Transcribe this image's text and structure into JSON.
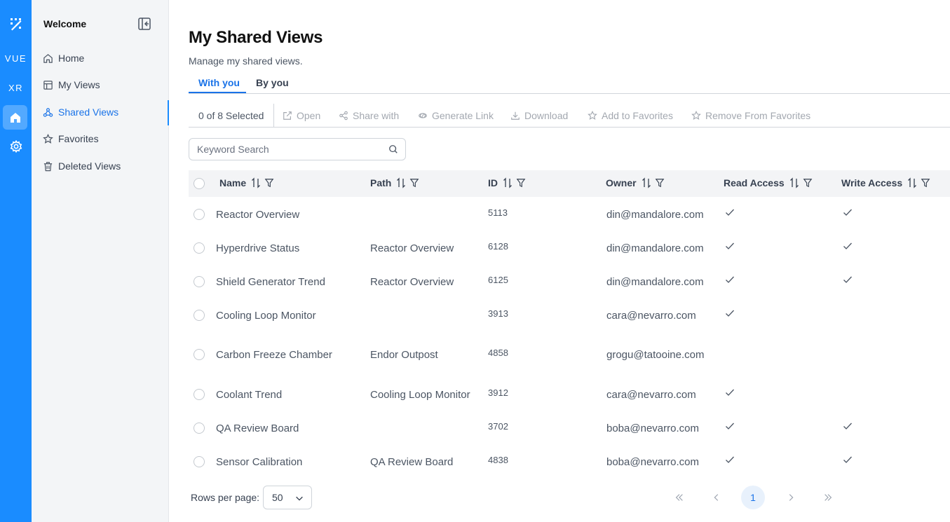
{
  "rail": {
    "logo_icon": "logo-icon",
    "vue_label": "VUE",
    "xr_label": "XR",
    "home_icon": "home-icon",
    "settings_icon": "gear-icon",
    "color": "#1a8cff"
  },
  "nav": {
    "title": "Welcome",
    "items": [
      {
        "label": "Home",
        "icon": "home-icon"
      },
      {
        "label": "My Views",
        "icon": "layout-icon"
      },
      {
        "label": "Shared Views",
        "icon": "share-nodes-icon",
        "active": true
      },
      {
        "label": "Favorites",
        "icon": "star-icon"
      },
      {
        "label": "Deleted Views",
        "icon": "trash-icon"
      }
    ]
  },
  "page": {
    "title": "My Shared Views",
    "subtitle": "Manage my shared views."
  },
  "tabs": [
    {
      "label": "With you",
      "active": true
    },
    {
      "label": "By you",
      "active": false
    }
  ],
  "toolbar": {
    "selected": "0 of 8 Selected",
    "actions": [
      {
        "label": "Open",
        "icon": "external-link-icon"
      },
      {
        "label": "Share with",
        "icon": "share-icon"
      },
      {
        "label": "Generate Link",
        "icon": "link-icon"
      },
      {
        "label": "Download",
        "icon": "download-icon"
      },
      {
        "label": "Add to Favorites",
        "icon": "star-icon"
      },
      {
        "label": "Remove From Favorites",
        "icon": "star-icon"
      }
    ]
  },
  "search": {
    "placeholder": "Keyword Search",
    "value": ""
  },
  "table": {
    "columns": [
      "Name",
      "Path",
      "ID",
      "Owner",
      "Read Access",
      "Write Access"
    ],
    "rows": [
      {
        "name": "Reactor Overview",
        "path": "",
        "id": "5113",
        "owner": "din@mandalore.com",
        "read": true,
        "write": true
      },
      {
        "name": "Hyperdrive Status",
        "path": "Reactor Overview",
        "id": "6128",
        "owner": "din@mandalore.com",
        "read": true,
        "write": true
      },
      {
        "name": "Shield Generator Trend",
        "path": "Reactor Overview",
        "id": "6125",
        "owner": "din@mandalore.com",
        "read": true,
        "write": true
      },
      {
        "name": "Cooling Loop Monitor",
        "path": "",
        "id": "3913",
        "owner": "cara@nevarro.com",
        "read": true,
        "write": false
      },
      {
        "name": "Carbon Freeze Chamber",
        "path": "Endor Outpost",
        "id": "4858",
        "owner": "grogu@tatooine.com",
        "read": false,
        "write": false
      },
      {
        "name": "Coolant Trend",
        "path": "Cooling Loop Monitor",
        "id": "3912",
        "owner": "cara@nevarro.com",
        "read": true,
        "write": false
      },
      {
        "name": "QA Review Board",
        "path": "",
        "id": "3702",
        "owner": "boba@nevarro.com",
        "read": true,
        "write": true
      },
      {
        "name": "Sensor Calibration",
        "path": "QA Review Board",
        "id": "4838",
        "owner": "boba@nevarro.com",
        "read": true,
        "write": true
      }
    ]
  },
  "footer": {
    "rows_per_page_label": "Rows per page:",
    "rows_per_page_value": "50",
    "first_icon": "double-chevron-left-icon",
    "prev_icon": "chevron-left-icon",
    "current_page": "1",
    "next_icon": "chevron-right-icon",
    "last_icon": "double-chevron-right-icon"
  },
  "colors": {
    "accent": "#1a73e8",
    "rail": "#1a8cff",
    "muted_action": "#a3a8b0"
  }
}
